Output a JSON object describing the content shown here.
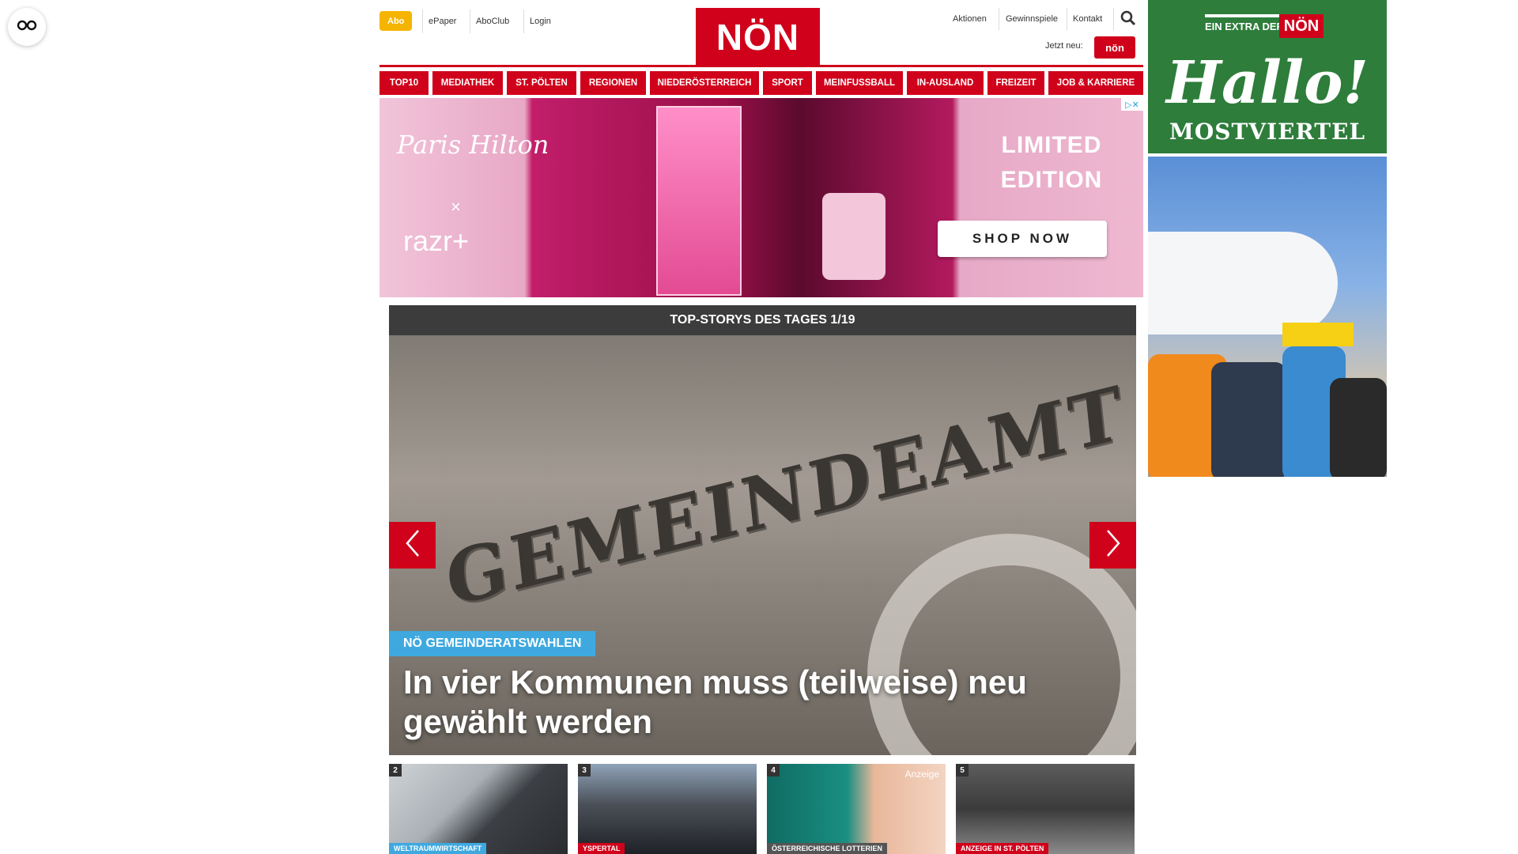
{
  "header": {
    "abo_label": "Abo",
    "util_links": [
      "ePaper",
      "AboClub",
      "Login"
    ],
    "logo_text": "NÖN",
    "right_links": [
      "Aktionen",
      "Gewinnspiele",
      "Kontakt"
    ],
    "jetzt_neu_label": "Jetzt neu:",
    "mini_logo_text": "nön"
  },
  "nav": {
    "items": [
      "TOP10",
      "MEDIATHEK",
      "ST. PÖLTEN",
      "REGIONEN",
      "NIEDERÖSTERREICH",
      "SPORT",
      "MEINFUSSBALL",
      "IN-AUSLAND",
      "FREIZEIT",
      "JOB & KARRIERE"
    ]
  },
  "ad_banner": {
    "brand": "Paris Hilton",
    "cross": "×",
    "razr": "razr+",
    "limited": "LIMITED EDITION",
    "cta": "SHOP NOW",
    "choices": "▷✕"
  },
  "top_stories": {
    "header": "TOP-STORYS DES TAGES 1/19",
    "hero": {
      "sign_text": "GEMEINDEAMT",
      "tag": "NÖ GEMEINDERATSWAHLEN",
      "title": "In vier Kommunen muss (teilweise) neu gewählt werden"
    },
    "thumbs": [
      {
        "num": "2",
        "tag": "WELTRAUMWIRTSCHAFT",
        "tag_color": "#3fa9df"
      },
      {
        "num": "3",
        "tag": "YSPERTAL",
        "tag_color": "#d0021b"
      },
      {
        "num": "4",
        "tag": "ÖSTERREICHISCHE LOTTERIEN",
        "tag_color": "#555555",
        "anzeige": "Anzeige"
      },
      {
        "num": "5",
        "tag": "ANZEIGE IN ST. PÖLTEN",
        "tag_color": "#d0021b"
      }
    ]
  },
  "side_ads": {
    "extra_label": "EIN EXTRA DER",
    "extra_logo": "NÖN",
    "hallo": "Hallo!",
    "region": "MOSTVIERTEL"
  },
  "colors": {
    "brand_red": "#d0021b",
    "abo_yellow": "#f5b400",
    "tag_blue": "#3fa9df",
    "side_green": "#2e7d3b"
  },
  "icons": {
    "reader": "reader-glasses-icon",
    "search": "search-icon",
    "prev": "chevron-left-icon",
    "next": "chevron-right-icon"
  }
}
